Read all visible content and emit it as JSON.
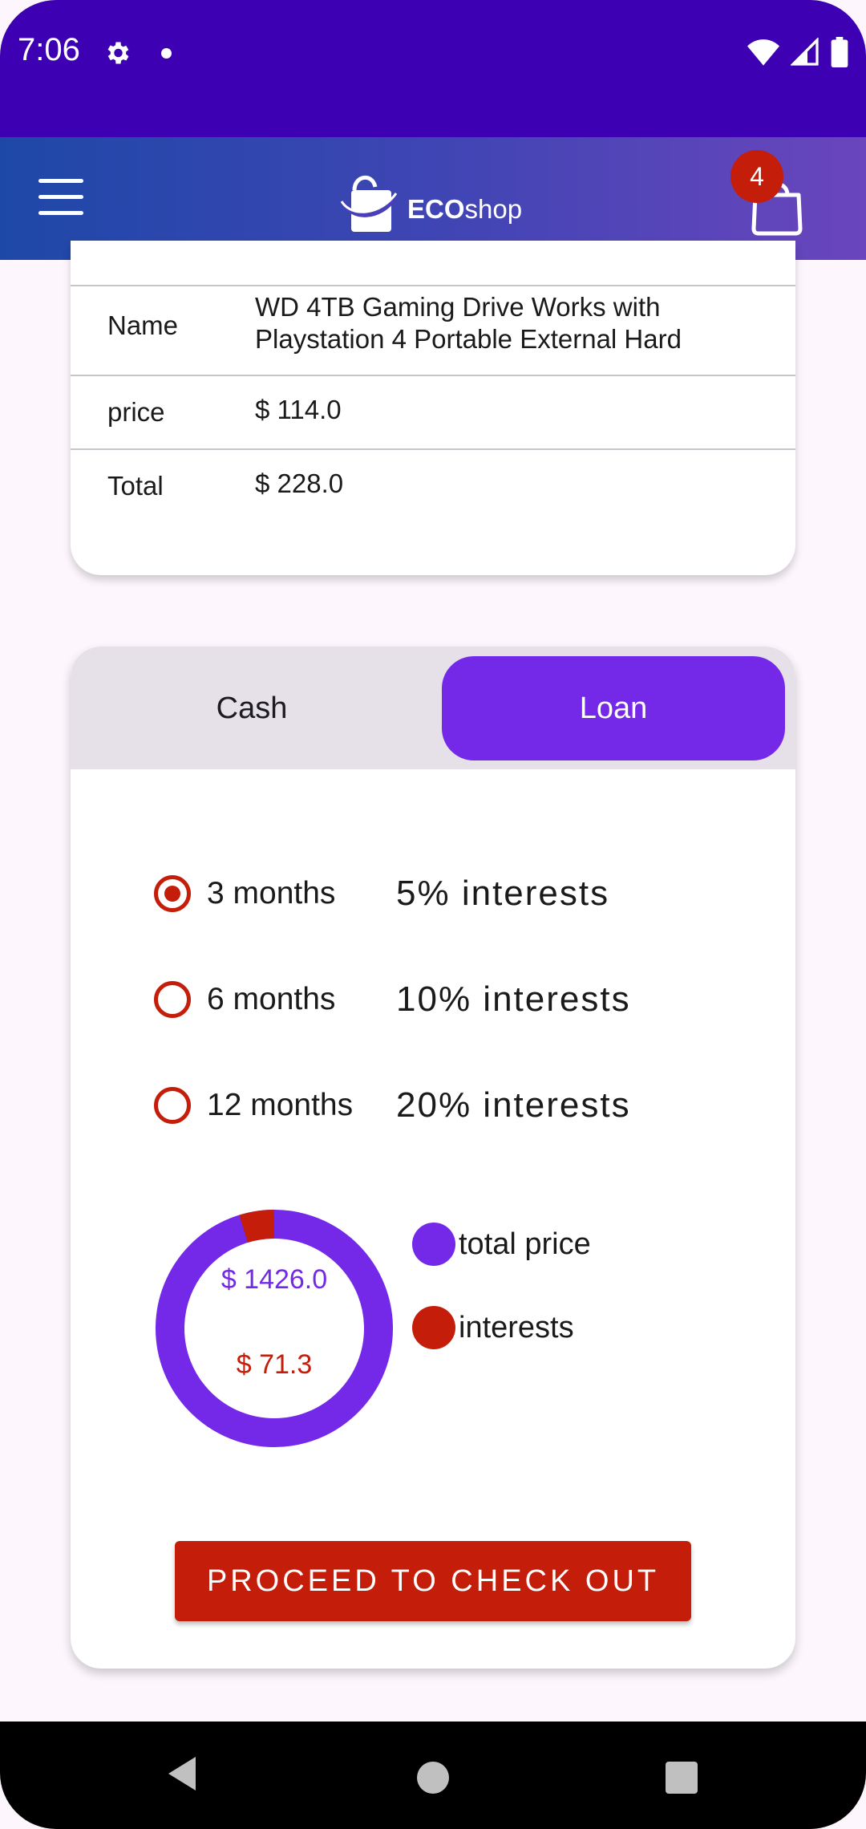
{
  "status_bar": {
    "time": "7:06"
  },
  "app_bar": {
    "logo_bold": "ECO",
    "logo_rest": "shop",
    "cart_count": "4"
  },
  "product": {
    "rows": [
      {
        "label": "Name",
        "value": "WD 4TB Gaming Drive Works with Playstation 4 Portable External Hard"
      },
      {
        "label": "price",
        "value": "$ 114.0"
      },
      {
        "label": "Total",
        "value": "$ 228.0"
      }
    ]
  },
  "payment": {
    "tabs": {
      "cash": "Cash",
      "loan": "Loan",
      "selected": "Loan"
    },
    "options": [
      {
        "months": "3 months",
        "interest": "5% interests",
        "checked": true
      },
      {
        "months": "6 months",
        "interest": "10% interests",
        "checked": false
      },
      {
        "months": "12 months",
        "interest": "20% interests",
        "checked": false
      }
    ],
    "chart": {
      "total_label": "$ 1426.0",
      "interest_label": "$ 71.3",
      "legend_total": "total price",
      "legend_interest": "interests"
    },
    "checkout_label": "PROCEED TO CHECK OUT"
  },
  "colors": {
    "primary": "#7428e8",
    "accent": "#c41d0a",
    "status_bar": "#3d00b3"
  },
  "chart_data": {
    "type": "pie",
    "categories": [
      "total price",
      "interests"
    ],
    "values": [
      1426.0,
      71.3
    ],
    "legend": "right"
  }
}
